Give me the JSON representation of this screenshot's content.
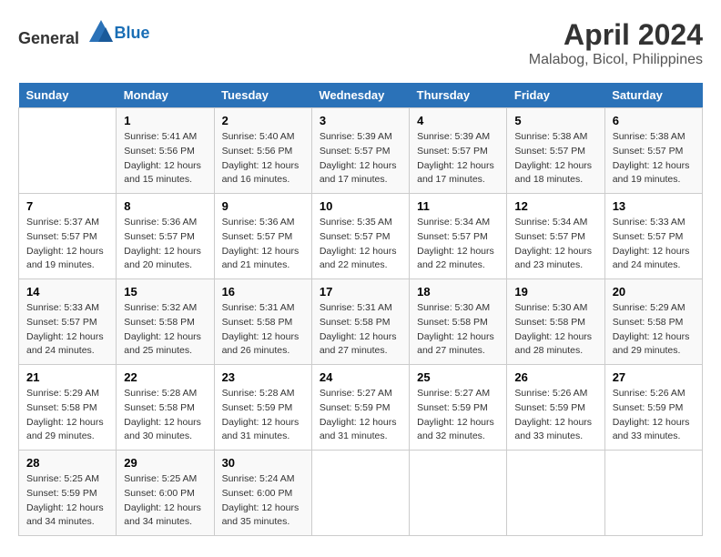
{
  "logo": {
    "general": "General",
    "blue": "Blue"
  },
  "title": "April 2024",
  "subtitle": "Malabog, Bicol, Philippines",
  "days_header": [
    "Sunday",
    "Monday",
    "Tuesday",
    "Wednesday",
    "Thursday",
    "Friday",
    "Saturday"
  ],
  "weeks": [
    [
      {
        "day": "",
        "info": ""
      },
      {
        "day": "1",
        "info": "Sunrise: 5:41 AM\nSunset: 5:56 PM\nDaylight: 12 hours\nand 15 minutes."
      },
      {
        "day": "2",
        "info": "Sunrise: 5:40 AM\nSunset: 5:56 PM\nDaylight: 12 hours\nand 16 minutes."
      },
      {
        "day": "3",
        "info": "Sunrise: 5:39 AM\nSunset: 5:57 PM\nDaylight: 12 hours\nand 17 minutes."
      },
      {
        "day": "4",
        "info": "Sunrise: 5:39 AM\nSunset: 5:57 PM\nDaylight: 12 hours\nand 17 minutes."
      },
      {
        "day": "5",
        "info": "Sunrise: 5:38 AM\nSunset: 5:57 PM\nDaylight: 12 hours\nand 18 minutes."
      },
      {
        "day": "6",
        "info": "Sunrise: 5:38 AM\nSunset: 5:57 PM\nDaylight: 12 hours\nand 19 minutes."
      }
    ],
    [
      {
        "day": "7",
        "info": "Sunrise: 5:37 AM\nSunset: 5:57 PM\nDaylight: 12 hours\nand 19 minutes."
      },
      {
        "day": "8",
        "info": "Sunrise: 5:36 AM\nSunset: 5:57 PM\nDaylight: 12 hours\nand 20 minutes."
      },
      {
        "day": "9",
        "info": "Sunrise: 5:36 AM\nSunset: 5:57 PM\nDaylight: 12 hours\nand 21 minutes."
      },
      {
        "day": "10",
        "info": "Sunrise: 5:35 AM\nSunset: 5:57 PM\nDaylight: 12 hours\nand 22 minutes."
      },
      {
        "day": "11",
        "info": "Sunrise: 5:34 AM\nSunset: 5:57 PM\nDaylight: 12 hours\nand 22 minutes."
      },
      {
        "day": "12",
        "info": "Sunrise: 5:34 AM\nSunset: 5:57 PM\nDaylight: 12 hours\nand 23 minutes."
      },
      {
        "day": "13",
        "info": "Sunrise: 5:33 AM\nSunset: 5:57 PM\nDaylight: 12 hours\nand 24 minutes."
      }
    ],
    [
      {
        "day": "14",
        "info": "Sunrise: 5:33 AM\nSunset: 5:57 PM\nDaylight: 12 hours\nand 24 minutes."
      },
      {
        "day": "15",
        "info": "Sunrise: 5:32 AM\nSunset: 5:58 PM\nDaylight: 12 hours\nand 25 minutes."
      },
      {
        "day": "16",
        "info": "Sunrise: 5:31 AM\nSunset: 5:58 PM\nDaylight: 12 hours\nand 26 minutes."
      },
      {
        "day": "17",
        "info": "Sunrise: 5:31 AM\nSunset: 5:58 PM\nDaylight: 12 hours\nand 27 minutes."
      },
      {
        "day": "18",
        "info": "Sunrise: 5:30 AM\nSunset: 5:58 PM\nDaylight: 12 hours\nand 27 minutes."
      },
      {
        "day": "19",
        "info": "Sunrise: 5:30 AM\nSunset: 5:58 PM\nDaylight: 12 hours\nand 28 minutes."
      },
      {
        "day": "20",
        "info": "Sunrise: 5:29 AM\nSunset: 5:58 PM\nDaylight: 12 hours\nand 29 minutes."
      }
    ],
    [
      {
        "day": "21",
        "info": "Sunrise: 5:29 AM\nSunset: 5:58 PM\nDaylight: 12 hours\nand 29 minutes."
      },
      {
        "day": "22",
        "info": "Sunrise: 5:28 AM\nSunset: 5:58 PM\nDaylight: 12 hours\nand 30 minutes."
      },
      {
        "day": "23",
        "info": "Sunrise: 5:28 AM\nSunset: 5:59 PM\nDaylight: 12 hours\nand 31 minutes."
      },
      {
        "day": "24",
        "info": "Sunrise: 5:27 AM\nSunset: 5:59 PM\nDaylight: 12 hours\nand 31 minutes."
      },
      {
        "day": "25",
        "info": "Sunrise: 5:27 AM\nSunset: 5:59 PM\nDaylight: 12 hours\nand 32 minutes."
      },
      {
        "day": "26",
        "info": "Sunrise: 5:26 AM\nSunset: 5:59 PM\nDaylight: 12 hours\nand 33 minutes."
      },
      {
        "day": "27",
        "info": "Sunrise: 5:26 AM\nSunset: 5:59 PM\nDaylight: 12 hours\nand 33 minutes."
      }
    ],
    [
      {
        "day": "28",
        "info": "Sunrise: 5:25 AM\nSunset: 5:59 PM\nDaylight: 12 hours\nand 34 minutes."
      },
      {
        "day": "29",
        "info": "Sunrise: 5:25 AM\nSunset: 6:00 PM\nDaylight: 12 hours\nand 34 minutes."
      },
      {
        "day": "30",
        "info": "Sunrise: 5:24 AM\nSunset: 6:00 PM\nDaylight: 12 hours\nand 35 minutes."
      },
      {
        "day": "",
        "info": ""
      },
      {
        "day": "",
        "info": ""
      },
      {
        "day": "",
        "info": ""
      },
      {
        "day": "",
        "info": ""
      }
    ]
  ]
}
